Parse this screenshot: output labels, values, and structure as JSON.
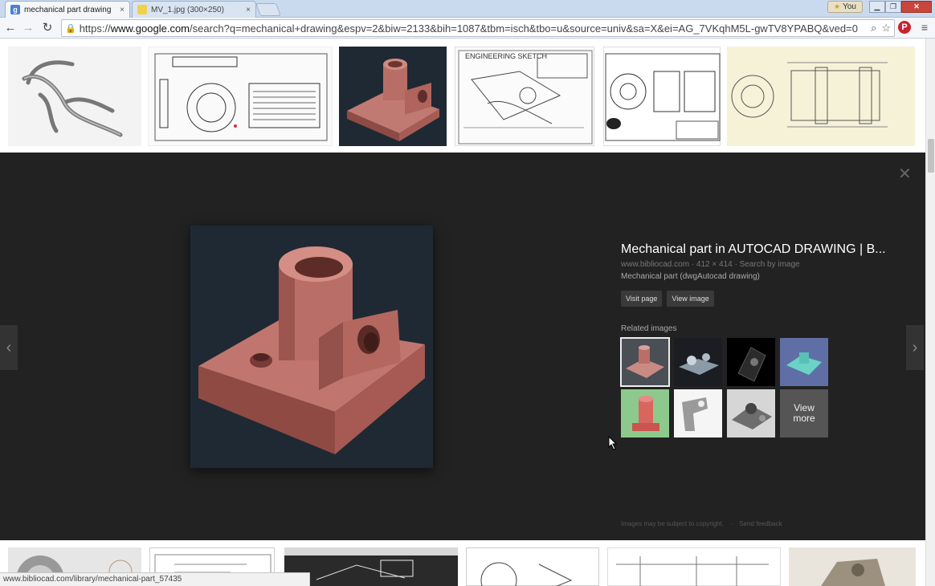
{
  "browser": {
    "tabs": [
      {
        "title": "mechanical part drawing",
        "active": true
      },
      {
        "title": "MV_1.jpg (300×250)",
        "active": false
      }
    ],
    "tab_close_glyph": "×",
    "profile_name": "You",
    "url_host": "www.google.com",
    "url_prefix": "https://",
    "url_rest": "/search?q=mechanical+drawing&espv=2&biw=2133&bih=1087&tbm=isch&tbo=u&source=univ&sa=X&ei=AG_7VKqhM5L-gwTV8YPABQ&ved=0"
  },
  "detail": {
    "title": "Mechanical part in AUTOCAD DRAWING | B...",
    "meta": "www.bibliocad.com · 412 × 414 · Search by image",
    "description": "Mechanical part (dwgAutocad drawing)",
    "visit_button": "Visit page",
    "view_button": "View image",
    "related_heading": "Related images",
    "view_more": "View more",
    "footer_copyright": "Images may be subject to copyright.",
    "footer_feedback": "Send feedback"
  },
  "thumb_annotation": "ENGINEERING SKETCH",
  "status_url": "www.bibliocad.com/library/mechanical-part_57435",
  "colors": {
    "accent_part": "#b46a62",
    "panel_bg": "#222222",
    "image_bg": "#1f2933"
  }
}
